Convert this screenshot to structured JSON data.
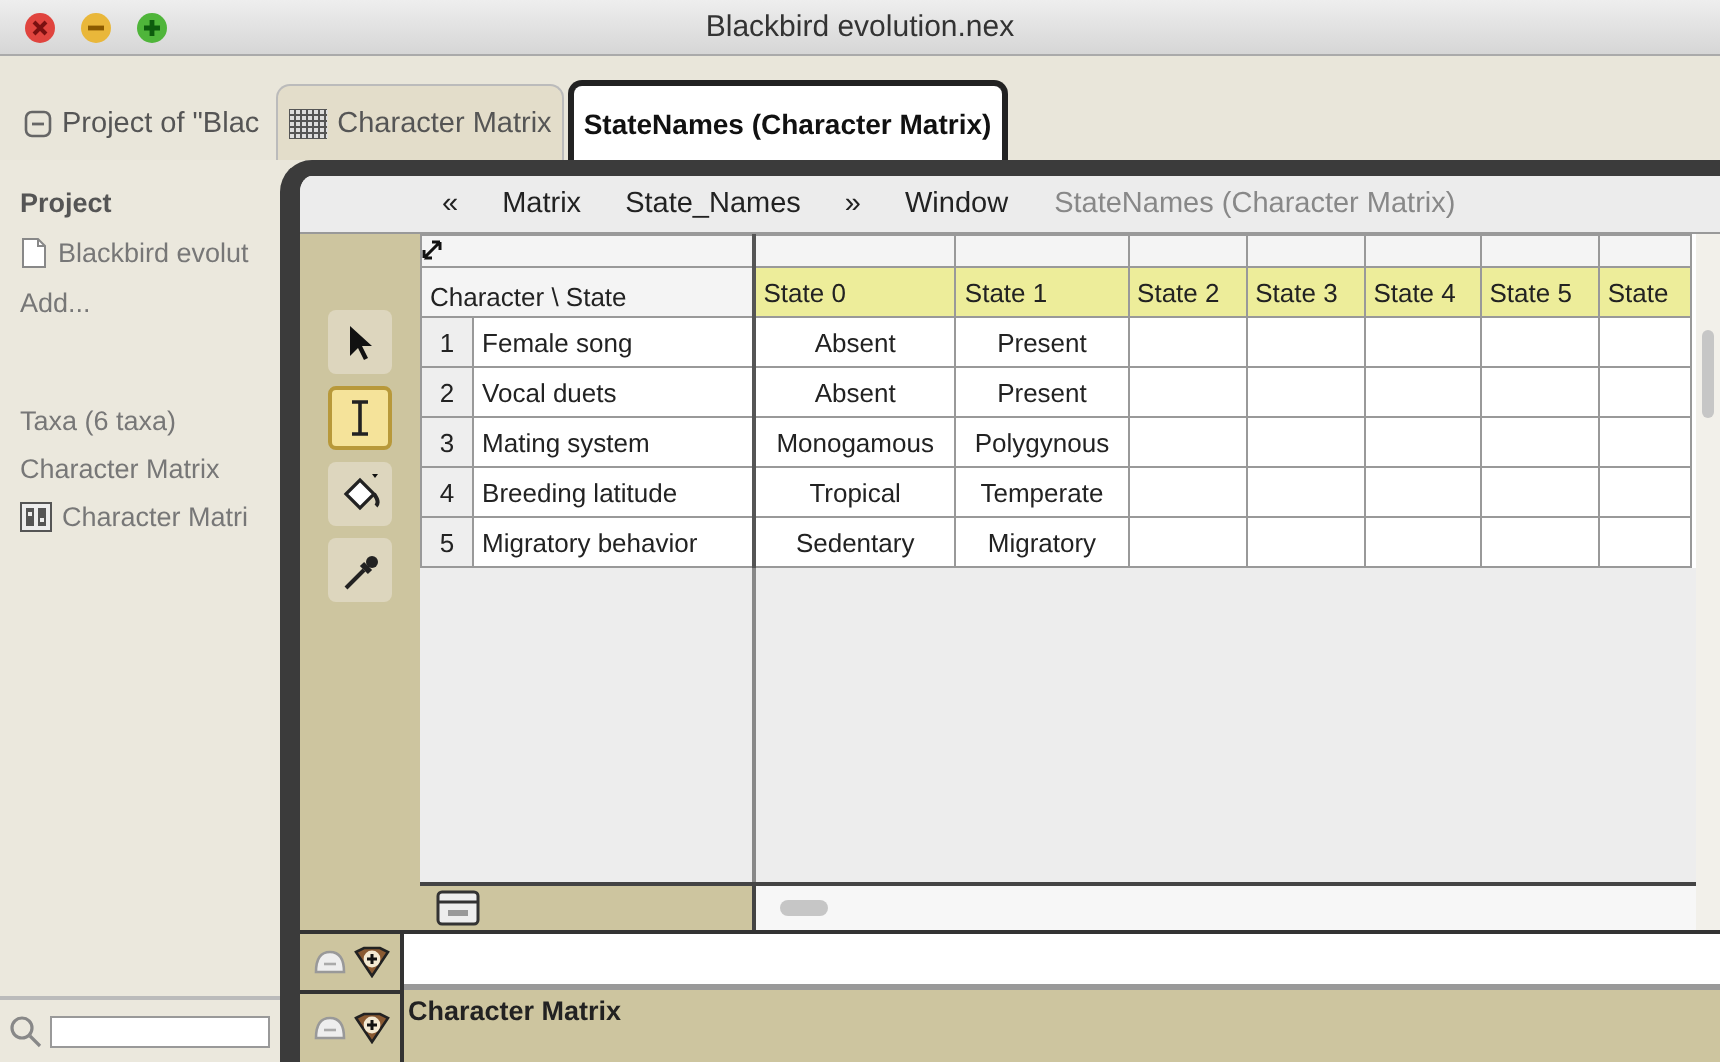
{
  "window": {
    "title": "Blackbird evolution.nex"
  },
  "tabs": [
    {
      "label": "Project of \"Blac",
      "kind": "project",
      "selected": false
    },
    {
      "label": "Character Matrix",
      "kind": "matrix",
      "selected": false
    },
    {
      "label": "StateNames (Character Matrix)",
      "kind": "plain",
      "selected": true
    }
  ],
  "sidebar": {
    "heading": "Project",
    "file": "Blackbird evolut",
    "add": "Add...",
    "elements": [
      {
        "label": "Taxa (6 taxa)",
        "kind": "text"
      },
      {
        "label": "Character Matrix",
        "kind": "text"
      },
      {
        "label": "Character Matri",
        "kind": "matrix"
      }
    ]
  },
  "menu": {
    "items": [
      "«",
      "Matrix",
      "State_Names",
      "»",
      "Window"
    ],
    "context": "StateNames (Character Matrix)"
  },
  "tools": [
    {
      "kind": "arrow",
      "selected": false
    },
    {
      "kind": "ibeam",
      "selected": true
    },
    {
      "kind": "bucket",
      "selected": false
    },
    {
      "kind": "dropper",
      "selected": false
    }
  ],
  "table": {
    "corner": "Character \\ State",
    "columns": [
      "State 0",
      "State 1",
      "State 2",
      "State 3",
      "State 4",
      "State 5",
      "State"
    ],
    "rows": [
      {
        "number": "1",
        "name": "Female song",
        "cells": [
          "Absent",
          "Present"
        ]
      },
      {
        "number": "2",
        "name": "Vocal duets",
        "cells": [
          "Absent",
          "Present"
        ]
      },
      {
        "number": "3",
        "name": "Mating system",
        "cells": [
          "Monogamous",
          "Polygynous"
        ]
      },
      {
        "number": "4",
        "name": "Breeding latitude",
        "cells": [
          "Tropical",
          "Temperate"
        ]
      },
      {
        "number": "5",
        "name": "Migratory behavior",
        "cells": [
          "Sedentary",
          "Migratory"
        ]
      }
    ]
  },
  "bottom": {
    "label": "Character Matrix"
  }
}
